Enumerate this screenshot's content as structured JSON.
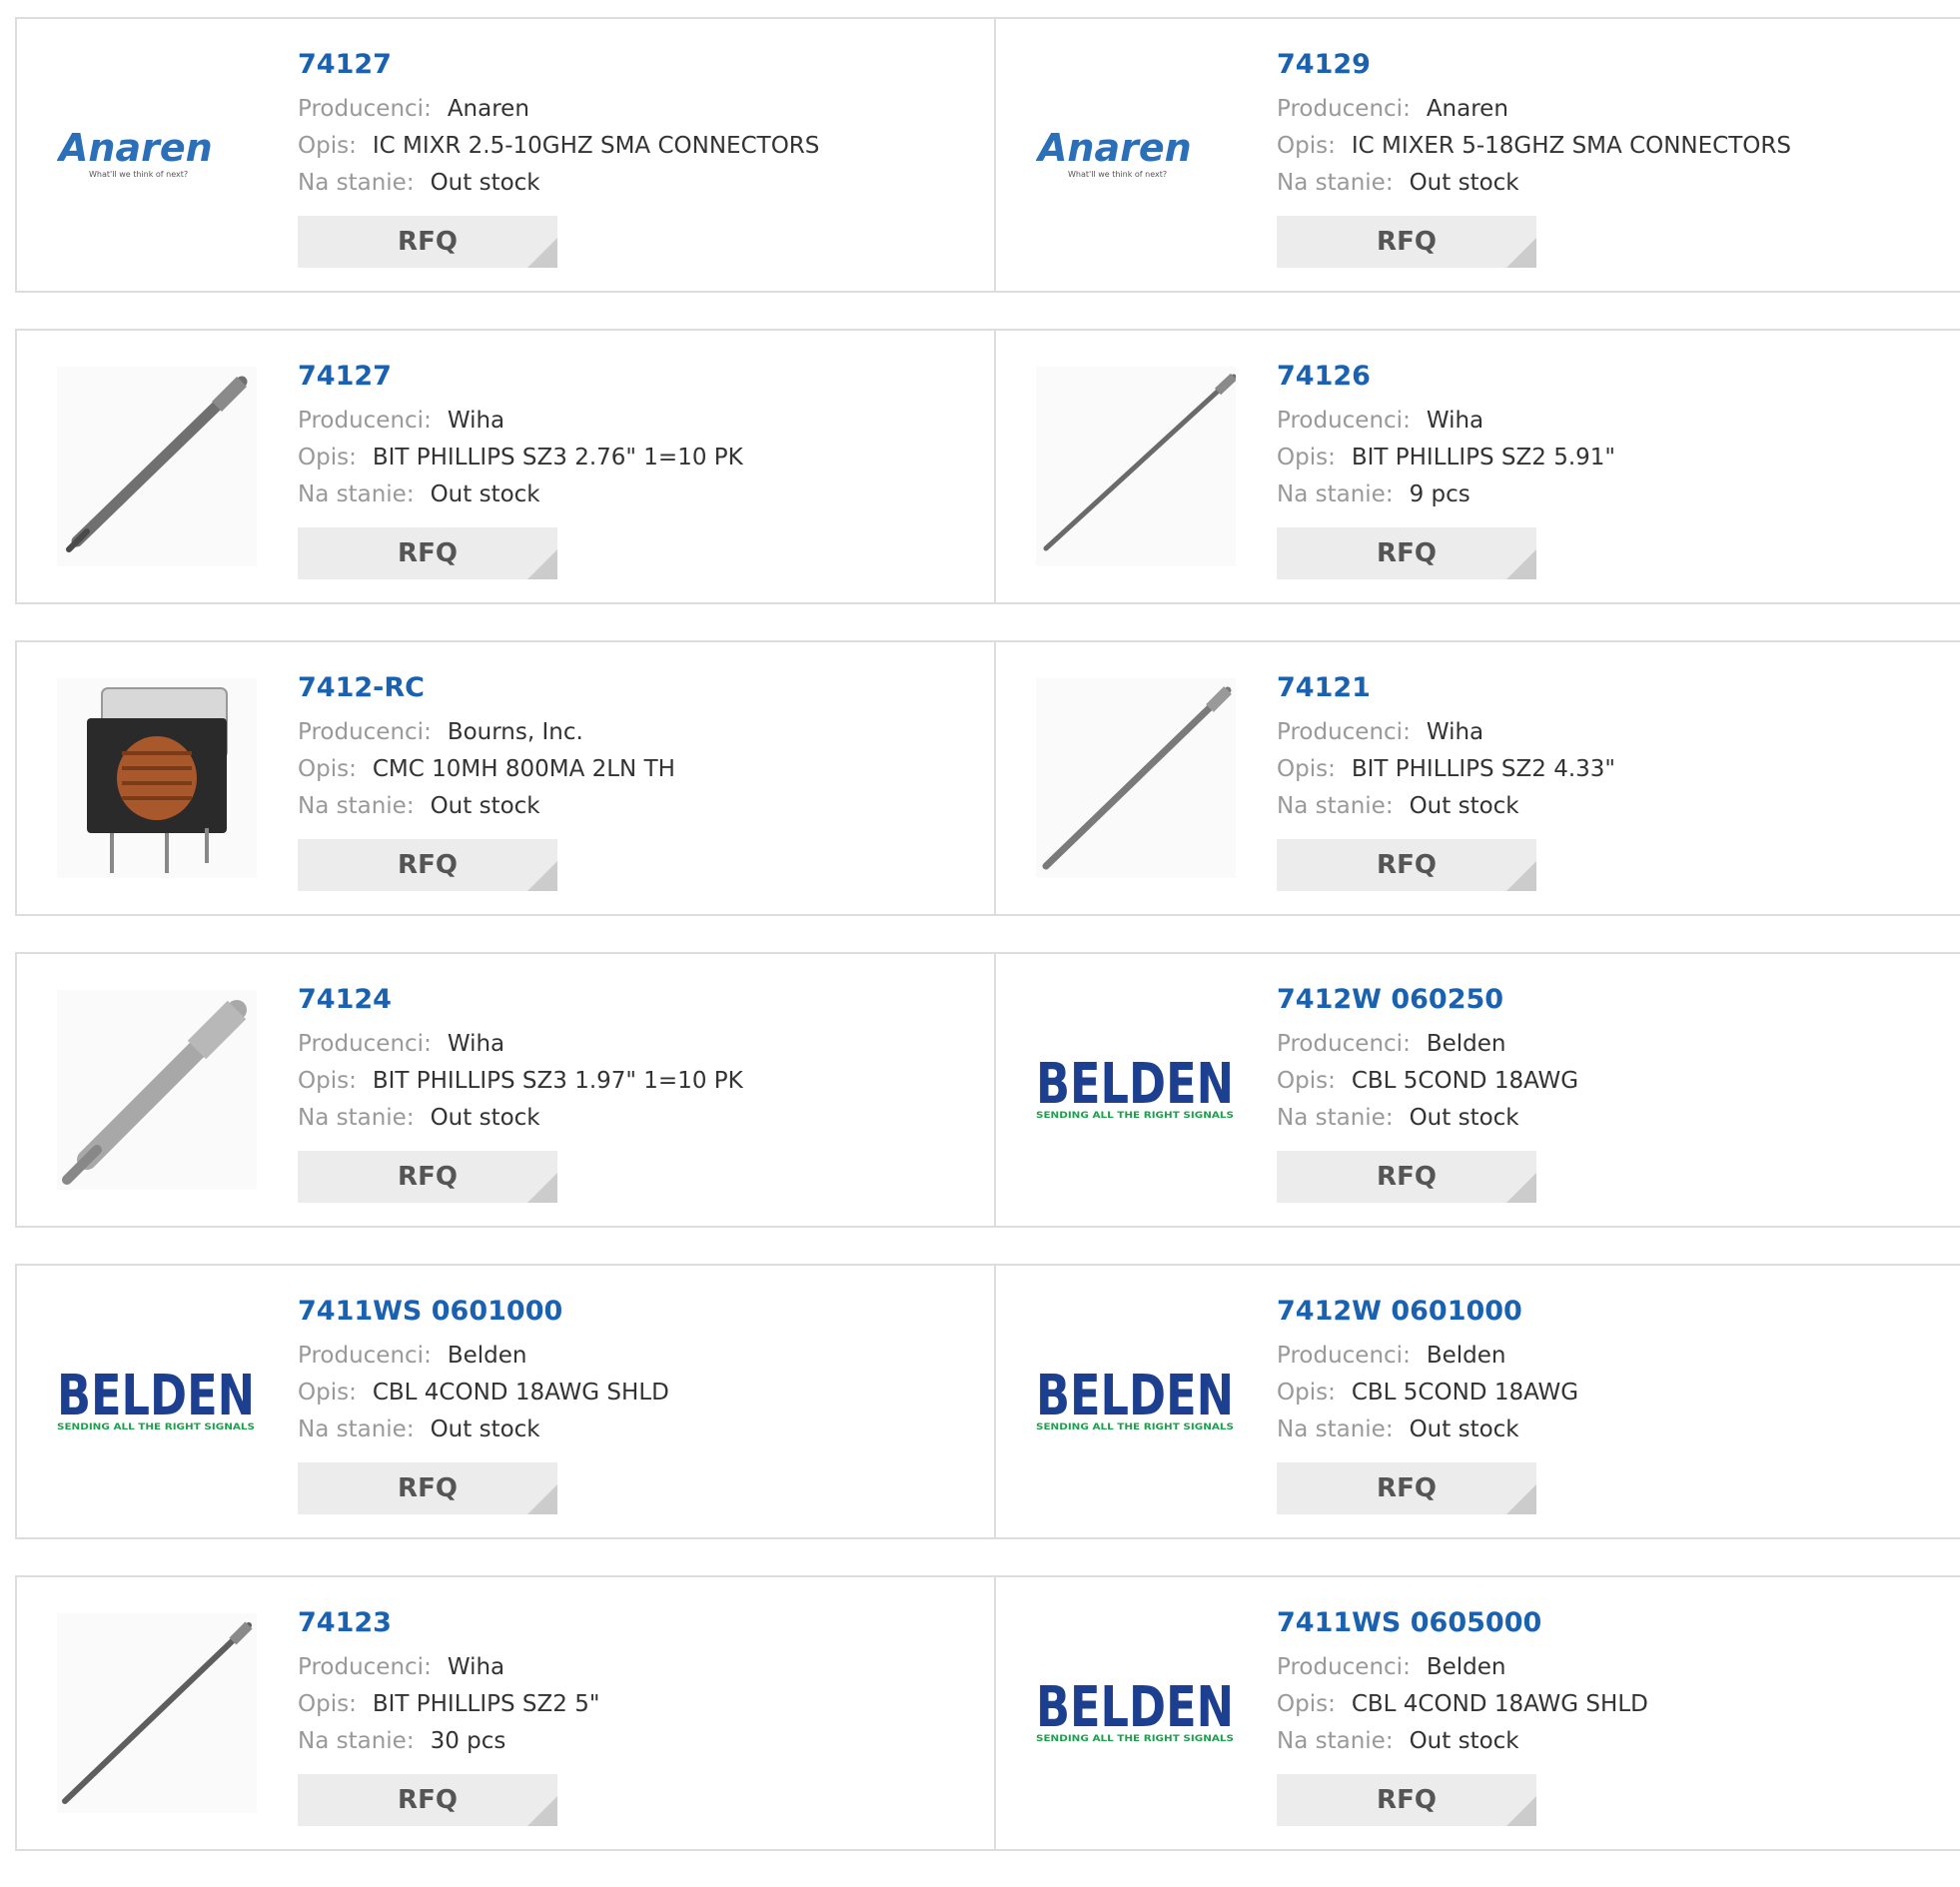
{
  "labels": {
    "manufacturer": "Producenci:",
    "description": "Opis:",
    "stock": "Na stanie:",
    "rfq": "RFQ"
  },
  "colors": {
    "part_link": "#1a62b0",
    "anaren_logo": "#2a6fb8",
    "belden_logo": "#1d3f8f",
    "belden_tagline": "#1aa24b"
  },
  "products": [
    {
      "part": "74127",
      "manufacturer": "Anaren",
      "description": "IC MIXR 2.5-10GHZ SMA CONNECTORS",
      "stock": "Out stock",
      "image": "anaren-logo",
      "logo_text": "Anaren",
      "logo_tagline": "What'll we think of next?"
    },
    {
      "part": "74129",
      "manufacturer": "Anaren",
      "description": "IC MIXER 5-18GHZ SMA CONNECTORS",
      "stock": "Out stock",
      "image": "anaren-logo",
      "logo_text": "Anaren",
      "logo_tagline": "What'll we think of next?"
    },
    {
      "part": "74127",
      "manufacturer": "Wiha",
      "description": "BIT PHILLIPS SZ3 2.76\" 1=10 PK",
      "stock": "Out stock",
      "image": "screwdriver-bit-photo"
    },
    {
      "part": "74126",
      "manufacturer": "Wiha",
      "description": "BIT PHILLIPS SZ2 5.91\"",
      "stock": "9 pcs",
      "image": "screwdriver-bit-photo"
    },
    {
      "part": "7412-RC",
      "manufacturer": "Bourns, Inc.",
      "description": "CMC 10MH 800MA 2LN TH",
      "stock": "Out stock",
      "image": "common-mode-choke-photo"
    },
    {
      "part": "74121",
      "manufacturer": "Wiha",
      "description": "BIT PHILLIPS SZ2 4.33\"",
      "stock": "Out stock",
      "image": "screwdriver-bit-photo"
    },
    {
      "part": "74124",
      "manufacturer": "Wiha",
      "description": "BIT PHILLIPS SZ3 1.97\" 1=10 PK",
      "stock": "Out stock",
      "image": "screwdriver-bit-photo"
    },
    {
      "part": "7412W 060250",
      "manufacturer": "Belden",
      "description": "CBL 5COND 18AWG",
      "stock": "Out stock",
      "image": "belden-logo",
      "logo_text": "BELDEN",
      "logo_tagline": "SENDING ALL THE RIGHT SIGNALS"
    },
    {
      "part": "7411WS 0601000",
      "manufacturer": "Belden",
      "description": "CBL 4COND 18AWG SHLD",
      "stock": "Out stock",
      "image": "belden-logo",
      "logo_text": "BELDEN",
      "logo_tagline": "SENDING ALL THE RIGHT SIGNALS"
    },
    {
      "part": "7412W 0601000",
      "manufacturer": "Belden",
      "description": "CBL 5COND 18AWG",
      "stock": "Out stock",
      "image": "belden-logo",
      "logo_text": "BELDEN",
      "logo_tagline": "SENDING ALL THE RIGHT SIGNALS"
    },
    {
      "part": "74123",
      "manufacturer": "Wiha",
      "description": "BIT PHILLIPS SZ2 5\"",
      "stock": "30 pcs",
      "image": "screwdriver-bit-photo"
    },
    {
      "part": "7411WS 0605000",
      "manufacturer": "Belden",
      "description": "CBL 4COND 18AWG SHLD",
      "stock": "Out stock",
      "image": "belden-logo",
      "logo_text": "BELDEN",
      "logo_tagline": "SENDING ALL THE RIGHT SIGNALS"
    }
  ]
}
